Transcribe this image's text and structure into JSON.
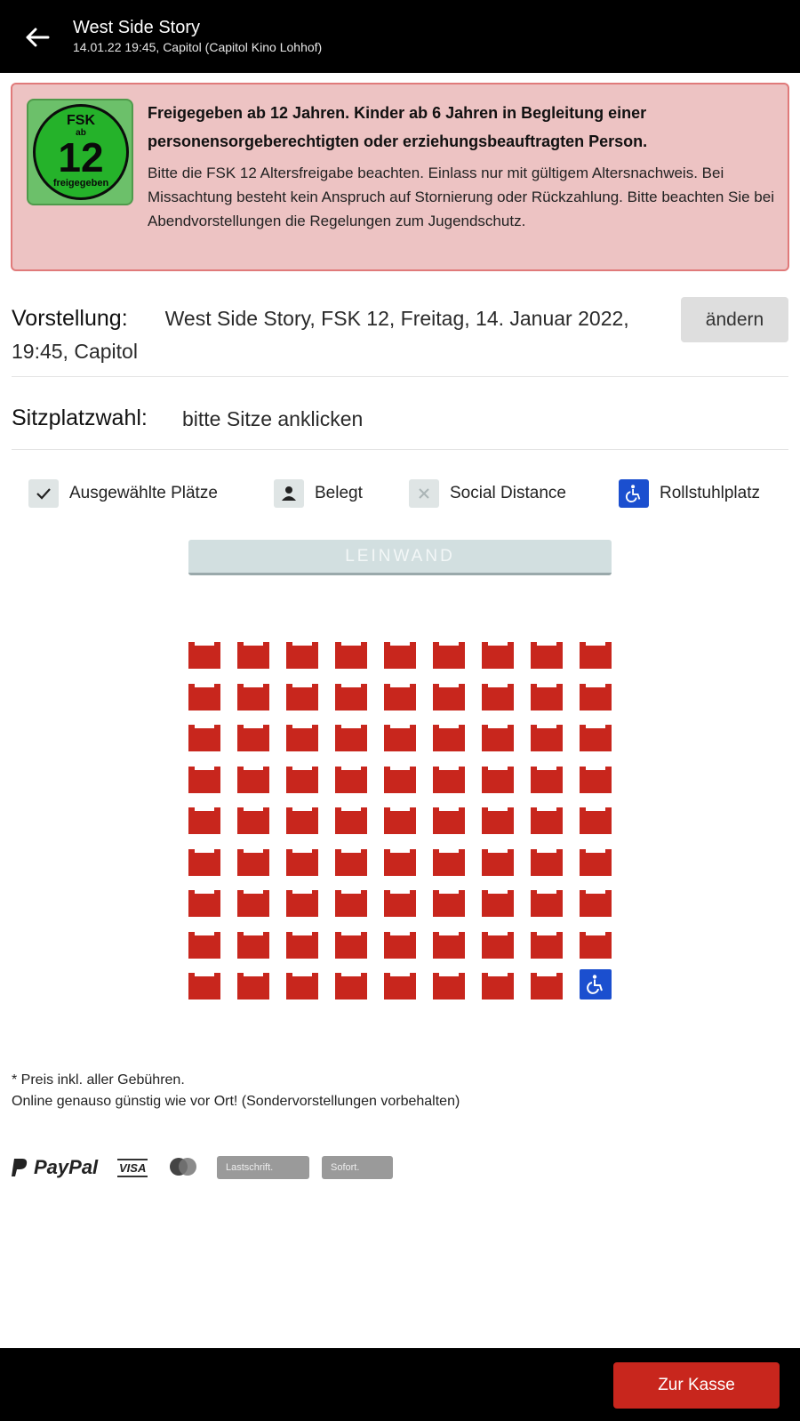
{
  "header": {
    "title": "West Side Story",
    "subtitle": "14.01.22 19:45, Capitol (Capitol Kino Lohhof)"
  },
  "warning": {
    "fsk_top": "FSK",
    "fsk_ab": "ab",
    "fsk_number": "12",
    "fsk_bottom": "freigegeben",
    "headline": "Freigegeben ab 12 Jahren. Kinder ab 6 Jahren in Begleitung einer personensorgeberechtigten oder erziehungsbeauftragten Person.",
    "body": "Bitte die FSK 12 Altersfreigabe beachten. Einlass nur mit gültigem Altersnachweis. Bei Missachtung besteht kein Anspruch auf Stornierung oder Rückzahlung. Bitte beachten Sie bei Abendvorstellungen die Regelungen zum Jugendschutz."
  },
  "performance": {
    "label": "Vorstellung:",
    "value": "West Side Story, FSK 12, Freitag, 14. Januar 2022, 19:45, Capitol",
    "change_label": "ändern"
  },
  "seat_selection": {
    "label": "Sitzplatzwahl:",
    "hint": "bitte Sitze anklicken"
  },
  "legend": {
    "selected": "Ausgewählte Plätze",
    "occupied": "Belegt",
    "social_distance": "Social Distance",
    "wheelchair": "Rollstuhlplatz"
  },
  "screen_label": "LEINWAND",
  "seat_map": {
    "rows": 9,
    "columns": 9,
    "seat_color": "#c8261d",
    "wheelchair_color": "#1b4fcf",
    "wheelchair_seats": [
      [
        9,
        9
      ]
    ]
  },
  "footnote": {
    "line1": "* Preis inkl. aller Gebühren.",
    "line2": "Online genauso günstig wie vor Ort! (Sondervorstellungen vorbehalten)"
  },
  "payments": {
    "paypal": "PayPal",
    "visa": "VISA",
    "lastschrift": "Lastschrift.",
    "sofort": "Sofort."
  },
  "checkout_label": "Zur Kasse"
}
